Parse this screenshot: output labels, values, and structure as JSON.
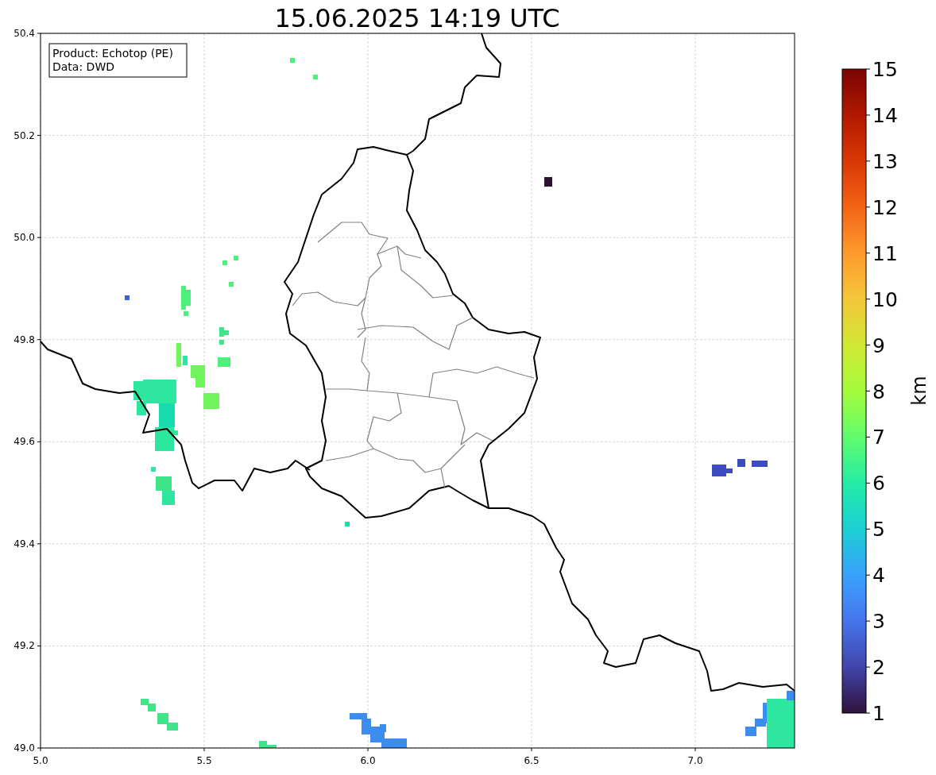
{
  "title": "15.06.2025 14:19 UTC",
  "info_box": {
    "lines": [
      "Product: Echotop (PE)",
      "Data: DWD"
    ]
  },
  "map": {
    "xticks": [
      "5.0",
      "5.5",
      "6.0",
      "6.5",
      "7.0"
    ],
    "yticks": [
      "50.4",
      "50.2",
      "50.0",
      "49.8",
      "49.6",
      "49.4",
      "49.2",
      "49.0"
    ]
  },
  "colorbar": {
    "label": "km",
    "ticks": [
      "15",
      "14",
      "13",
      "12",
      "11",
      "10",
      "9",
      "8",
      "7",
      "6",
      "5",
      "4",
      "3",
      "2",
      "1"
    ]
  }
}
